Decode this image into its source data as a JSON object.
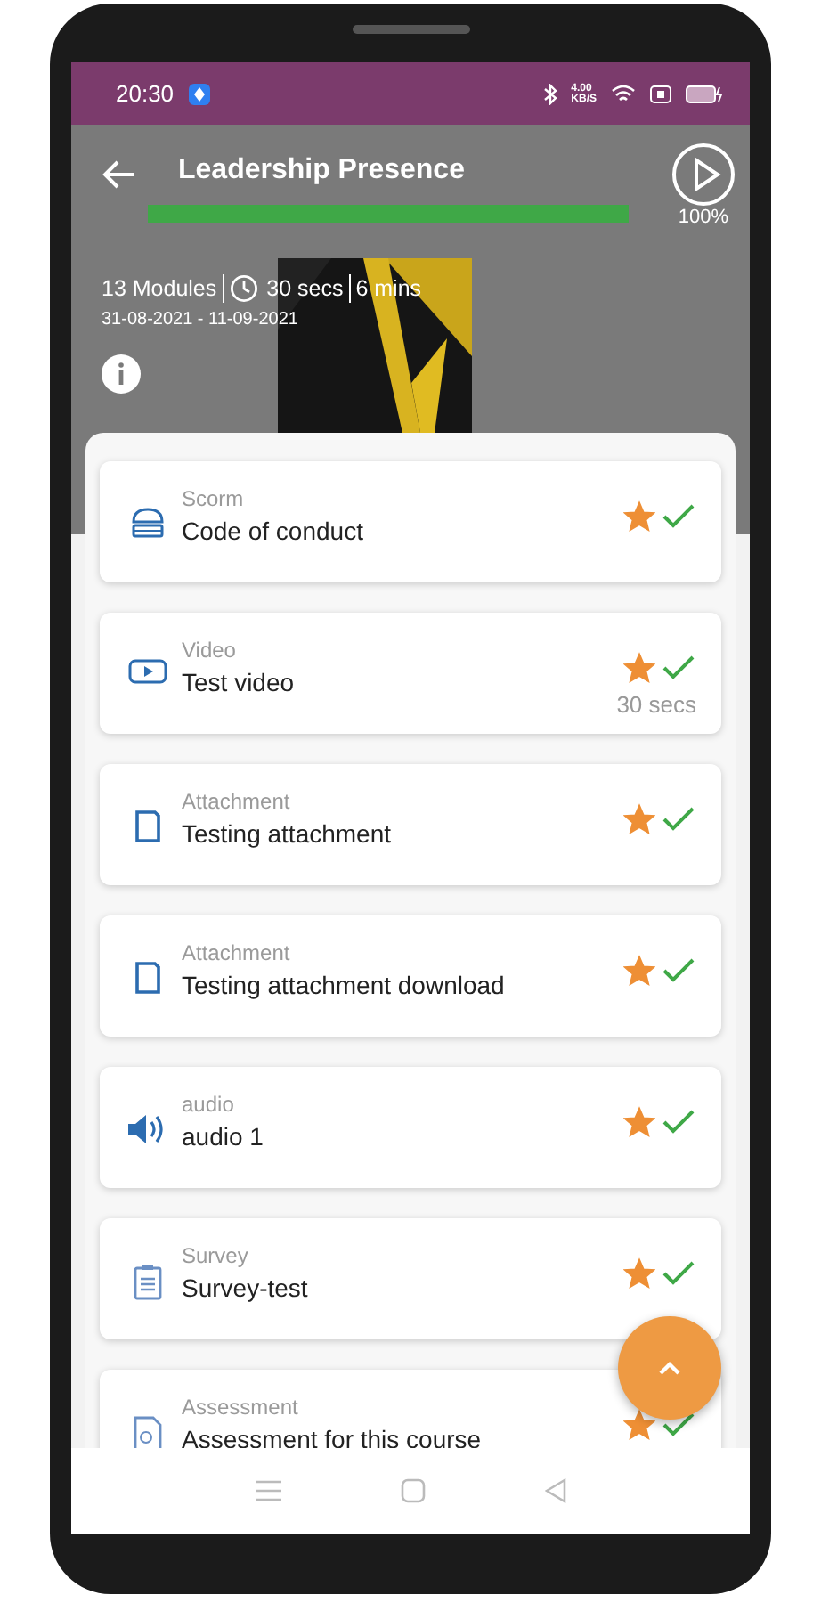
{
  "status_bar": {
    "time": "20:30",
    "speed": "4.00",
    "speed_unit": "KB/S"
  },
  "header": {
    "title": "Leadership Presence",
    "progress": {
      "level": 1,
      "reading": "100%"
    },
    "modules": "13 Modules",
    "duration_1": "30 secs",
    "duration_2": "6 mins",
    "dates": "31-08-2021 - 11-09-2021"
  },
  "modules": [
    {
      "kind": "scorm",
      "type": "Scorm",
      "title": "Code of conduct",
      "starred": true,
      "completed": true
    },
    {
      "kind": "video",
      "type": "Video",
      "title": "Test video",
      "starred": true,
      "completed": true,
      "duration": "30 secs"
    },
    {
      "kind": "attachment",
      "type": "Attachment",
      "title": "Testing attachment",
      "starred": true,
      "completed": true
    },
    {
      "kind": "attachment",
      "type": "Attachment",
      "title": "Testing attachment download",
      "starred": true,
      "completed": true
    },
    {
      "kind": "audio",
      "type": "audio",
      "title": "audio 1",
      "starred": true,
      "completed": true
    },
    {
      "kind": "survey",
      "type": "Survey",
      "title": "Survey-test",
      "starred": true,
      "completed": true
    },
    {
      "kind": "assessment",
      "type": "Assessment",
      "title": "Assessment for this course",
      "starred": true,
      "completed": true
    }
  ]
}
